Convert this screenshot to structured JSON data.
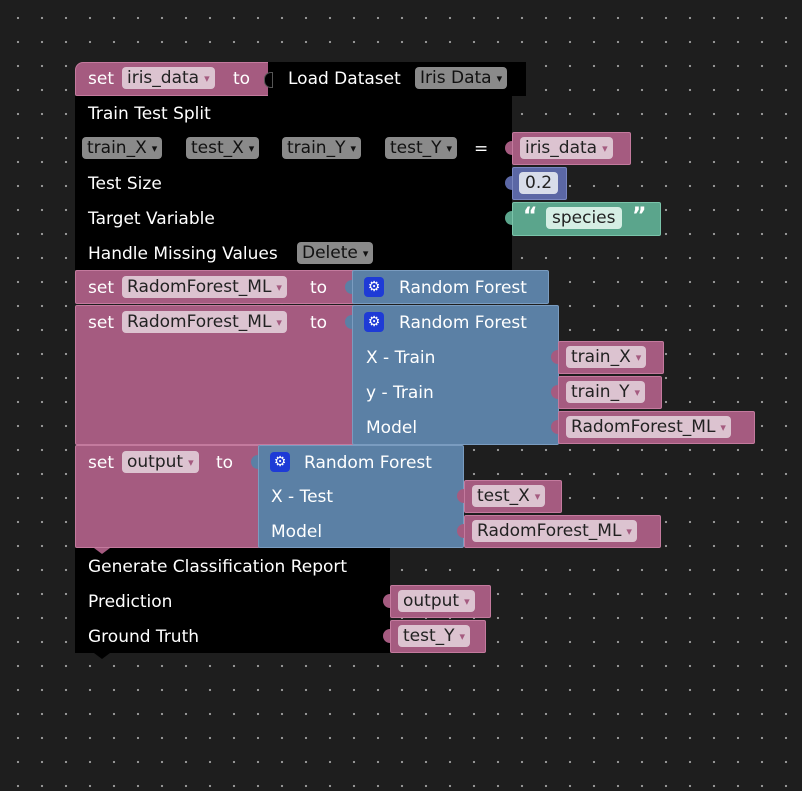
{
  "workspace": {
    "block1": {
      "set_kw": "set",
      "var": "iris_data",
      "to_kw": "to",
      "load_label": "Load Dataset",
      "dataset": "Iris Data"
    },
    "tts": {
      "title": "Train Test Split",
      "outputs": [
        "train_X",
        "test_X",
        "train_Y",
        "test_Y"
      ],
      "equals": "=",
      "input_var": "iris_data",
      "test_size_label": "Test Size",
      "test_size": "0.2",
      "target_label": "Target Variable",
      "target": "species",
      "quote_open": "“",
      "quote_close": "”",
      "missing_label": "Handle Missing Values",
      "missing_value": "Delete"
    },
    "rf1": {
      "set_kw": "set",
      "var": "RadomForest_ML",
      "to_kw": "to",
      "model_label": "Random Forest"
    },
    "rf2": {
      "set_kw": "set",
      "var": "RadomForest_ML",
      "to_kw": "to",
      "model_label": "Random Forest",
      "xtrain_label": "X - Train",
      "xtrain": "train_X",
      "ytrain_label": "y - Train",
      "ytrain": "train_Y",
      "model_field_label": "Model",
      "model": "RadomForest_ML"
    },
    "pred": {
      "set_kw": "set",
      "var": "output",
      "to_kw": "to",
      "model_label": "Random Forest",
      "xtest_label": "X - Test",
      "xtest": "test_X",
      "model_field_label": "Model",
      "model": "RadomForest_ML"
    },
    "report": {
      "title": "Generate Classification Report",
      "prediction_label": "Prediction",
      "prediction": "output",
      "truth_label": "Ground Truth",
      "truth": "test_Y"
    },
    "icons": {
      "dropdown": "▾",
      "gear": "⚙"
    }
  }
}
